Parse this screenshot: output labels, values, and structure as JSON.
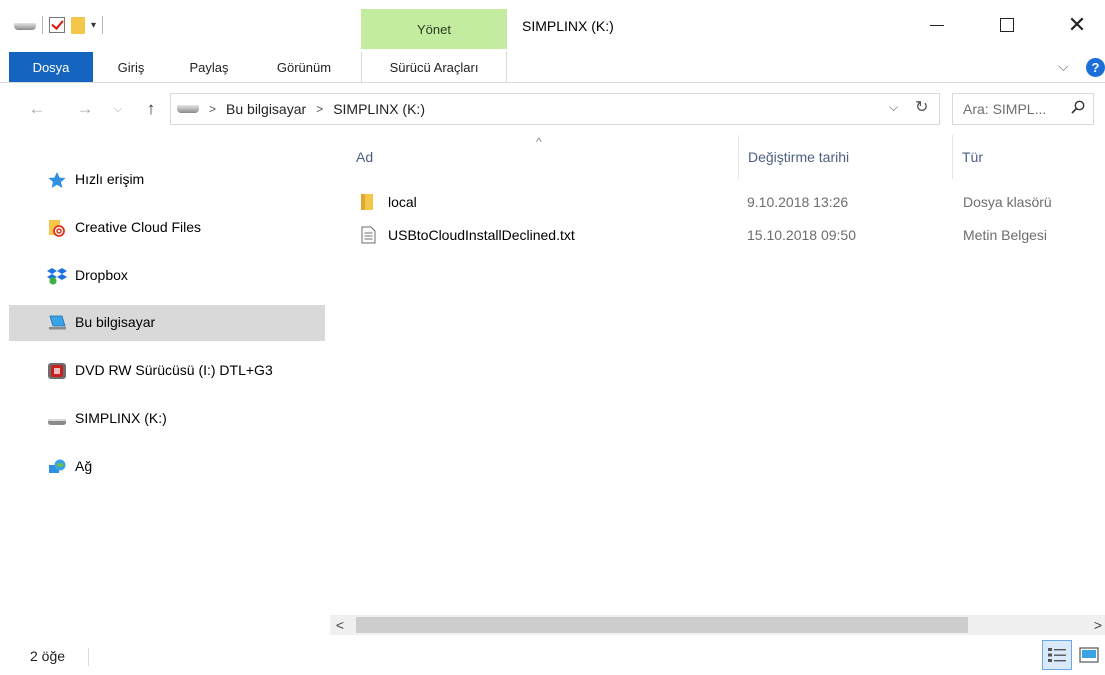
{
  "window": {
    "title": "SIMPLINX (K:)",
    "context_tab_group": "Yönet",
    "controls": {
      "minimize": "minimize",
      "maximize": "maximize",
      "close": "✕"
    }
  },
  "quick_access_toolbar": {
    "dropdown": "▾"
  },
  "ribbon": {
    "tabs": [
      {
        "label": "Dosya"
      },
      {
        "label": "Giriş"
      },
      {
        "label": "Paylaş"
      },
      {
        "label": "Görünüm"
      },
      {
        "label": "Sürücü Araçları"
      }
    ],
    "expand_glyph": "⌵",
    "help_glyph": "?"
  },
  "address": {
    "back_glyph": "←",
    "forward_glyph": "→",
    "recent_glyph": "⌵",
    "up_glyph": "↑",
    "breadcrumb": [
      "Bu bilgisayar",
      "SIMPLINX (K:)"
    ],
    "separator": ">",
    "dropdown_glyph": "⌵",
    "refresh_glyph": "↻"
  },
  "search": {
    "placeholder": "Ara: SIMPL..."
  },
  "navpane": {
    "items": [
      {
        "label": "Hızlı erişim",
        "icon": "star-icon"
      },
      {
        "label": "Creative Cloud Files",
        "icon": "creative-cloud-folder-icon"
      },
      {
        "label": "Dropbox",
        "icon": "dropbox-icon"
      },
      {
        "label": "Bu bilgisayar",
        "icon": "computer-icon",
        "selected": true
      },
      {
        "label": "DVD RW Sürücüsü (I:) DTL+G3",
        "icon": "dvd-drive-icon"
      },
      {
        "label": "SIMPLINX (K:)",
        "icon": "drive-icon"
      },
      {
        "label": "Ağ",
        "icon": "network-icon"
      }
    ]
  },
  "filelist": {
    "columns": {
      "name": "Ad",
      "date": "Değiştirme tarihi",
      "type": "Tür"
    },
    "sort_glyph": "^",
    "rows": [
      {
        "name": "local",
        "date": "9.10.2018 13:26",
        "type": "Dosya klasörü",
        "icon": "folder-icon"
      },
      {
        "name": "USBtoCloudInstallDeclined.txt",
        "date": "15.10.2018 09:50",
        "type": "Metin Belgesi",
        "icon": "text-file-icon"
      }
    ]
  },
  "scrollbar": {
    "left_glyph": "<",
    "right_glyph": ">"
  },
  "status": {
    "item_count": "2 öğe"
  },
  "colors": {
    "file_tab": "#1565c0",
    "manage_tab": "#c4eca0",
    "selected_nav": "#d9d9d9",
    "column_header_text": "#4d6082",
    "help": "#1d6fd8"
  }
}
